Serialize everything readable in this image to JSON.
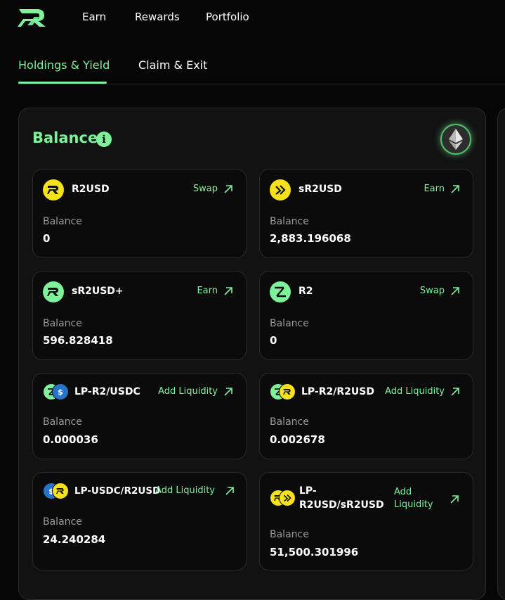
{
  "nav": {
    "items": [
      "Earn",
      "Rewards",
      "Portfolio"
    ]
  },
  "tabs": [
    "Holdings & Yield",
    "Claim & Exit"
  ],
  "balance": {
    "title": "Balance"
  },
  "labels": {
    "balance": "Balance"
  },
  "cards": [
    {
      "name": "R2USD",
      "action": "Swap",
      "value": "0",
      "icon": "r2usd-icon"
    },
    {
      "name": "sR2USD",
      "action": "Earn",
      "value": "2,883.196068",
      "icon": "sr2usd-icon"
    },
    {
      "name": "sR2USD+",
      "action": "Earn",
      "value": "596.828418",
      "icon": "sr2usd-plus-icon"
    },
    {
      "name": "R2",
      "action": "Swap",
      "value": "0",
      "icon": "r2-icon"
    },
    {
      "name": "LP-R2/USDC",
      "action": "Add Liquidity",
      "value": "0.000036",
      "icon": "lp-r2-usdc-icon"
    },
    {
      "name": "LP-R2/R2USD",
      "action": "Add Liquidity",
      "value": "0.002678",
      "icon": "lp-r2-r2usd-icon"
    },
    {
      "name": "LP-USDC/R2USD",
      "action": "Add Liquidity",
      "value": "24.240284",
      "icon": "lp-usdc-r2usd-icon"
    },
    {
      "name_line1": "LP-",
      "name_line2": "R2USD/sR2USD",
      "action_line1": "Add",
      "action_line2": "Liquidity",
      "value": "51,500.301996",
      "icon": "lp-r2usd-sr2usd-icon"
    }
  ],
  "colors": {
    "accent": "#7ef29a",
    "yellow": "#f5e21a",
    "usdc": "#2775ca",
    "background": "#060606",
    "panel": "#121213"
  }
}
